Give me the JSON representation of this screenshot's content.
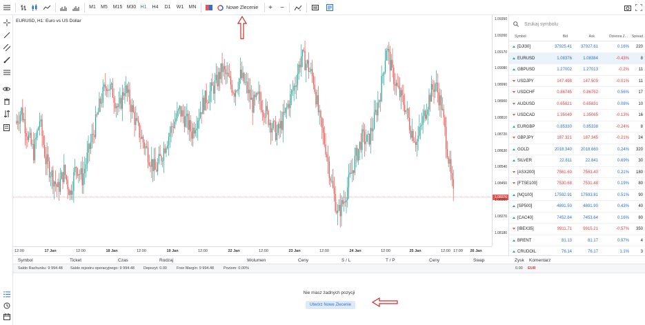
{
  "toolbar": {
    "timeframes": [
      "M1",
      "M5",
      "M15",
      "M30",
      "H1",
      "H4",
      "D1",
      "W1",
      "MN"
    ],
    "active_timeframe": "H1",
    "new_order_label": "Nowe Zlecenie",
    "plus": "+",
    "minus": "−"
  },
  "chart": {
    "title": "EURUSD, H1: Euro vs US Dollar",
    "current_price": "1.08376",
    "price_color": "#ef5350",
    "up_color": "#26a69a",
    "down_color": "#ef5350"
  },
  "chart_data": {
    "type": "candlestick",
    "title": "EURUSD, H1: Euro vs US Dollar",
    "ylim": [
      1.0813,
      1.0935
    ],
    "y_ticks": [
      "1.09350",
      "1.09260",
      "1.09170",
      "1.09080",
      "1.08990",
      "1.08900",
      "1.08810",
      "1.08720",
      "1.08630",
      "1.08540",
      "1.08450",
      "1.08360",
      "1.08270",
      "1.08180"
    ],
    "x_ticks": [
      {
        "label": "12:00",
        "bold": false
      },
      {
        "label": "17 Jan",
        "bold": true
      },
      {
        "label": "12:00",
        "bold": false
      },
      {
        "label": "18 Jan",
        "bold": true
      },
      {
        "label": "12:00",
        "bold": false
      },
      {
        "label": "19 Jan",
        "bold": true
      },
      {
        "label": "12:00",
        "bold": false
      },
      {
        "label": "22 Jan",
        "bold": true
      },
      {
        "label": "12:00",
        "bold": false
      },
      {
        "label": "23 Jan",
        "bold": true
      },
      {
        "label": "12:00",
        "bold": false
      },
      {
        "label": "24 Jan",
        "bold": true
      },
      {
        "label": "12:00",
        "bold": false
      },
      {
        "label": "25 Jan",
        "bold": true
      },
      {
        "label": "12:00",
        "bold": false
      },
      {
        "label": "17:00",
        "bold": false
      },
      {
        "label": "26 Jan",
        "bold": true
      }
    ],
    "close_path": [
      1.0878,
      1.0885,
      1.0872,
      1.0862,
      1.088,
      1.0858,
      1.085,
      1.0842,
      1.0852,
      1.084,
      1.0855,
      1.0848,
      1.0862,
      1.0875,
      1.089,
      1.09,
      1.0895,
      1.0885,
      1.0898,
      1.0888,
      1.0876,
      1.0868,
      1.086,
      1.0852,
      1.086,
      1.087,
      1.0878,
      1.0885,
      1.088,
      1.0873,
      1.0882,
      1.089,
      1.0895,
      1.09,
      1.0908,
      1.0902,
      1.0896,
      1.0904,
      1.0898,
      1.0888,
      1.0892,
      1.0885,
      1.0878,
      1.0872,
      1.088,
      1.089,
      1.09,
      1.0915,
      1.091,
      1.0902,
      1.088,
      1.0865,
      1.0845,
      1.0828,
      1.0836,
      1.0848,
      1.086,
      1.087,
      1.0868,
      1.088,
      1.0895,
      1.092,
      1.0905,
      1.0895,
      1.0888,
      1.0875,
      1.0868,
      1.088,
      1.0892,
      1.09,
      1.0888,
      1.0864,
      1.0838
    ]
  },
  "watchlist": {
    "search_placeholder": "Szukaj symbolu",
    "headers": {
      "symbol": "Symbol",
      "bid": "Bid",
      "ask": "Ask",
      "change": "Dzienna Z...",
      "spread": "Spread"
    },
    "rows": [
      {
        "dir": "up",
        "symbol": "[DJI30]",
        "bid": "37925.41",
        "ask": "37927.61",
        "change": "0.16%",
        "spread": "220",
        "bc": "blue",
        "cc": "blue"
      },
      {
        "dir": "up",
        "symbol": "EURUSD",
        "bid": "1.08376",
        "ask": "1.08384",
        "change": "-0.43%",
        "spread": "8",
        "bc": "blue",
        "cc": "red",
        "sel": true
      },
      {
        "dir": "up",
        "symbol": "GBPUSD",
        "bid": "1.27002",
        "ask": "1.27013",
        "change": "-0.2%",
        "spread": "11",
        "bc": "blue",
        "cc": "red"
      },
      {
        "dir": "down",
        "symbol": "USDJPY",
        "bid": "147.498",
        "ask": "147.509",
        "change": "-0.01%",
        "spread": "11",
        "bc": "red",
        "cc": "red"
      },
      {
        "dir": "down",
        "symbol": "USDCHF",
        "bid": "0.86745",
        "ask": "0.86762",
        "change": "0.56%",
        "spread": "17",
        "bc": "red",
        "cc": "blue"
      },
      {
        "dir": "down",
        "symbol": "AUDUSD",
        "bid": "0.65821",
        "ask": "0.65831",
        "change": "0.08%",
        "spread": "10",
        "bc": "red",
        "cc": "blue"
      },
      {
        "dir": "down",
        "symbol": "USDCAD",
        "bid": "1.35049",
        "ask": "1.35065",
        "change": "-0.13%",
        "spread": "16",
        "bc": "red",
        "cc": "red"
      },
      {
        "dir": "up",
        "symbol": "EURGBP",
        "bid": "0.85330",
        "ask": "0.85338",
        "change": "-0.24%",
        "spread": "8",
        "bc": "blue",
        "cc": "red"
      },
      {
        "dir": "down",
        "symbol": "GBPJPY",
        "bid": "187.321",
        "ask": "187.345",
        "change": "-0.21%",
        "spread": "24",
        "bc": "red",
        "cc": "red"
      },
      {
        "dir": "up",
        "symbol": "GOLD",
        "bid": "2018.340",
        "ask": "2018.660",
        "change": "0.24%",
        "spread": "320",
        "bc": "blue",
        "cc": "blue"
      },
      {
        "dir": "up",
        "symbol": "SILVER",
        "bid": "22.811",
        "ask": "22.841",
        "change": "0.69%",
        "spread": "30",
        "bc": "blue",
        "cc": "blue"
      },
      {
        "dir": "down",
        "symbol": "[ASX200]",
        "bid": "7561.60",
        "ask": "7563.40",
        "change": "0.21%",
        "spread": "180",
        "bc": "red",
        "cc": "blue"
      },
      {
        "dir": "down",
        "symbol": "[FTSE100]",
        "bid": "7530.68",
        "ask": "7531.48",
        "change": "0.19%",
        "spread": "80",
        "bc": "red",
        "cc": "blue"
      },
      {
        "dir": "up",
        "symbol": "[NQ100]",
        "bid": "17592.91",
        "ask": "17593.81",
        "change": "0.51%",
        "spread": "90",
        "bc": "blue",
        "cc": "blue"
      },
      {
        "dir": "up",
        "symbol": "[SP500]",
        "bid": "4891.50",
        "ask": "4891.90",
        "change": "0.43%",
        "spread": "40",
        "bc": "blue",
        "cc": "blue"
      },
      {
        "dir": "up",
        "symbol": "[CAC40]",
        "bid": "7452.84",
        "ask": "7453.64",
        "change": "0.16%",
        "spread": "80",
        "bc": "blue",
        "cc": "blue"
      },
      {
        "dir": "down",
        "symbol": "[IBEX35]",
        "bid": "9911.71",
        "ask": "9915.21",
        "change": "-0.57%",
        "spread": "350",
        "bc": "red",
        "cc": "red"
      },
      {
        "dir": "up",
        "symbol": "BRENT",
        "bid": "81.13",
        "ask": "81.17",
        "change": "0.97%",
        "spread": "4",
        "bc": "blue",
        "cc": "blue"
      },
      {
        "dir": "up",
        "symbol": "CRUDOIL",
        "bid": "76.14",
        "ask": "76.17",
        "change": "1.1%",
        "spread": "3",
        "bc": "blue",
        "cc": "blue"
      }
    ]
  },
  "positions": {
    "headers": [
      "Symbol",
      "Ticket",
      "Czas",
      "Rodzaj",
      "Wolumen",
      "Ceny",
      "S / L",
      "T / P",
      "Ceny",
      "Swap",
      "Zysk",
      "Komentarz"
    ],
    "account": {
      "balance": "Saldo Rachunku: 9 994.48",
      "op_balance": "Saldo rejestru operacyjnego: 9 994.48",
      "deposit": "Depozyt: 0.00",
      "free_margin": "Free Margin: 9 994.48",
      "level": "Poziom: 0.00%",
      "profit": "0.00",
      "currency": "EUR"
    },
    "empty_message": "Nie masz żadnych pozycji",
    "new_order_button": "Utwórz Nowe Zlecenie"
  }
}
